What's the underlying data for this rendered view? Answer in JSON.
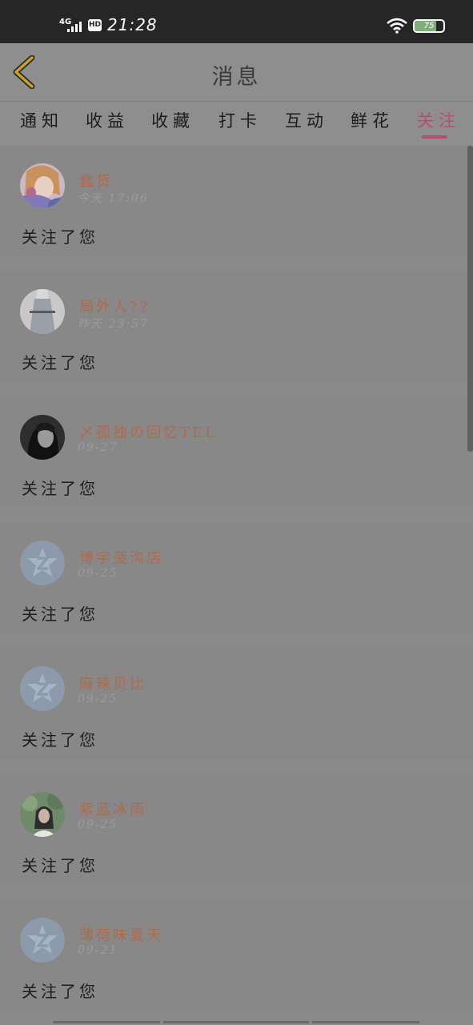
{
  "status_bar": {
    "network": "4G",
    "hd": "HD",
    "time": "21:28",
    "battery": "75",
    "battery_level": 0.75
  },
  "header": {
    "title": "消息",
    "back_icon": "chevron-left-icon"
  },
  "tabs": [
    {
      "label": "通知",
      "active": false
    },
    {
      "label": "收益",
      "active": false
    },
    {
      "label": "收藏",
      "active": false
    },
    {
      "label": "打卡",
      "active": false
    },
    {
      "label": "互动",
      "active": false
    },
    {
      "label": "鲜花",
      "active": false
    },
    {
      "label": "关注",
      "active": true
    }
  ],
  "notifications": [
    {
      "username": "蠢货",
      "time": "今天 17:06",
      "message": "关注了您",
      "avatar": "anime-avatar"
    },
    {
      "username": "局外人??",
      "time": "昨天 23:57",
      "message": "关注了您",
      "avatar": "photo-avatar"
    },
    {
      "username": "〆孤独の回忆TEL",
      "time": "09-27",
      "message": "关注了您",
      "avatar": "photo-avatar"
    },
    {
      "username": "博宇菠沟店",
      "time": "09-25",
      "message": "关注了您",
      "avatar": "default-avatar"
    },
    {
      "username": "麻辣贝比",
      "time": "09-25",
      "message": "关注了您",
      "avatar": "default-avatar"
    },
    {
      "username": "紫蓝冰雨",
      "time": "09-25",
      "message": "关注了您",
      "avatar": "photo-avatar"
    },
    {
      "username": "薄荷味夏天",
      "time": "09-21",
      "message": "关注了您",
      "avatar": "default-avatar"
    }
  ],
  "colors": {
    "accent": "#b4506f",
    "username": "#b06a4a",
    "back_icon": "#c9a227"
  }
}
